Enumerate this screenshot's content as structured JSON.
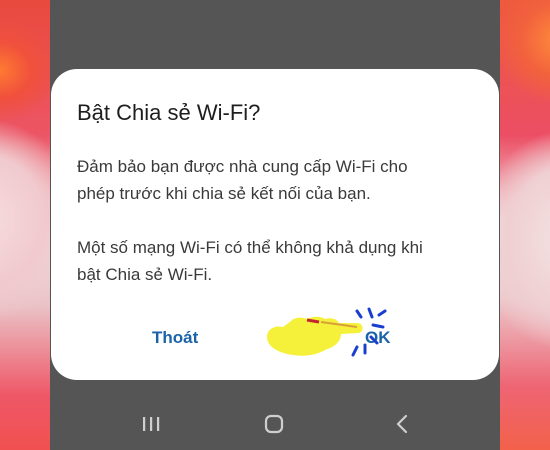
{
  "dialog": {
    "title": "Bật Chia sẻ Wi-Fi?",
    "paragraph1": "Đảm bảo bạn được nhà cung cấp Wi-Fi cho\nphép trước khi chia sẻ kết nối của bạn.",
    "paragraph2": "Một số mạng Wi-Fi có thể không khả dụng khi\nbật Chia sẻ Wi-Fi.",
    "cancel_label": "Thoát",
    "ok_label": "OK"
  },
  "nav": {
    "recents_icon": "recents-icon",
    "home_icon": "home-icon",
    "back_icon": "back-icon"
  },
  "colors": {
    "accent": "#1a63a8",
    "dim_overlay": "#555555",
    "dialog_bg": "#ffffff",
    "pointer_hand": "#f5f03a",
    "click_rays": "#1a3fd0"
  },
  "overlay_icons": {
    "pointer": "pointing-hand-icon"
  }
}
